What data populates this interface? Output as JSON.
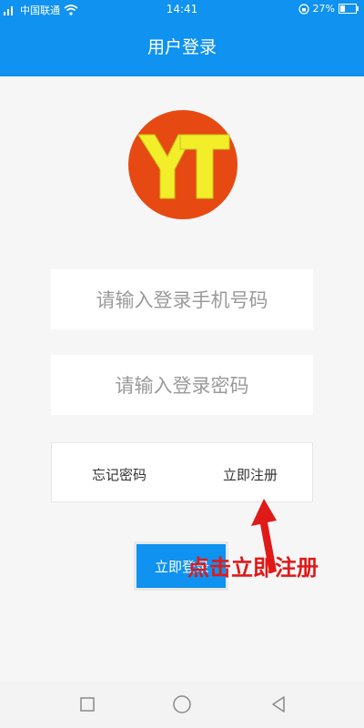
{
  "status_bar": {
    "carrier": "中国联通",
    "time": "14:41",
    "battery": "27%"
  },
  "header": {
    "title": "用户登录"
  },
  "logo": {
    "text": "YT",
    "colors": {
      "circle": "#e64a12",
      "letters": "#f2ee2a"
    }
  },
  "form": {
    "phone_placeholder": "请输入登录手机号码",
    "password_placeholder": "请输入登录密码",
    "forgot_label": "忘记密码",
    "register_label": "立即注册",
    "login_label": "立即登录"
  },
  "annotation": {
    "text": "点击立即注册",
    "color": "#e01919"
  },
  "nav": {
    "icons": [
      "recent-apps-icon",
      "home-icon",
      "back-icon"
    ]
  },
  "colors": {
    "primary": "#0f92f0",
    "background": "#f6f6f6"
  }
}
